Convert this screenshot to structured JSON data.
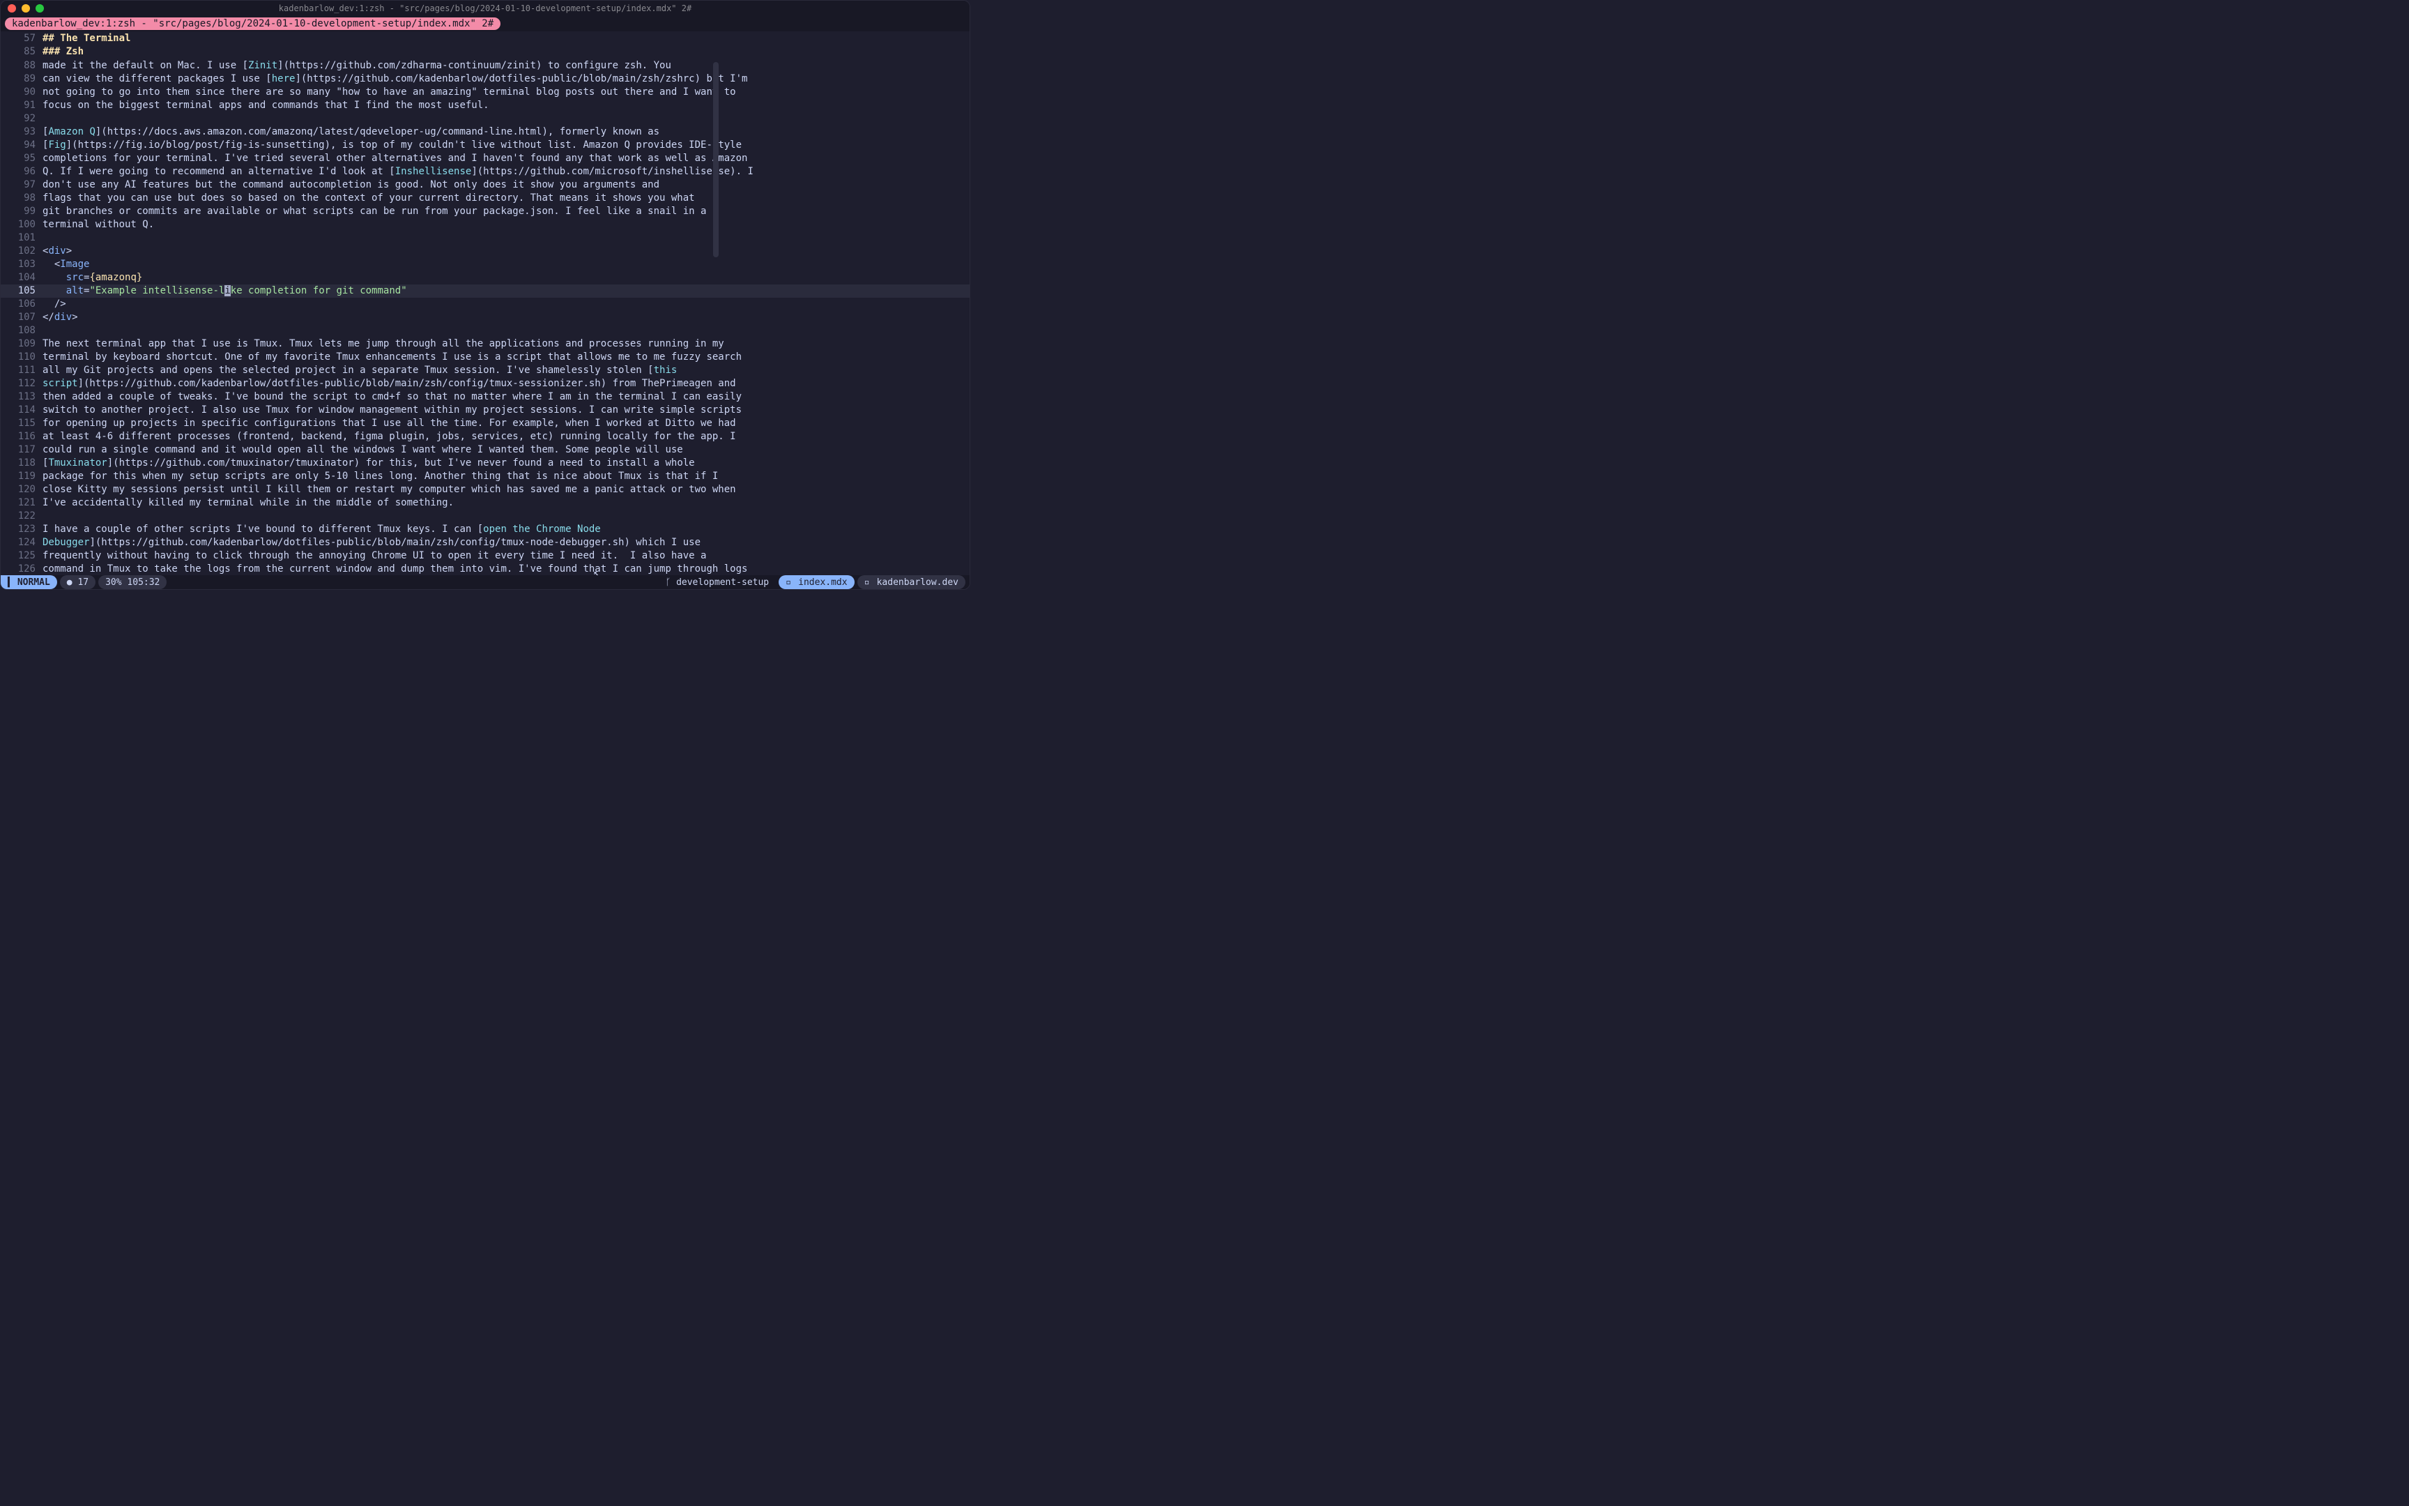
{
  "window": {
    "title": "kadenbarlow_dev:1:zsh - \"src/pages/blog/2024-01-10-development-setup/index.mdx\" 2#"
  },
  "tmux": {
    "tab": "kadenbarlow_dev:1:zsh - \"src/pages/blog/2024-01-10-development-setup/index.mdx\" 2#"
  },
  "breadcrumbs": [
    {
      "num": "57",
      "text": "## The Terminal"
    },
    {
      "num": "85",
      "text": "### Zsh"
    }
  ],
  "lines": [
    {
      "num": "88",
      "segs": [
        [
          "t",
          "made it the default on Mac. I use ["
        ],
        [
          "l",
          "Zinit"
        ],
        [
          "t",
          "](https://github.com/zdharma-continuum/zinit) to configure zsh. You"
        ]
      ]
    },
    {
      "num": "89",
      "segs": [
        [
          "t",
          "can view the different packages I use ["
        ],
        [
          "l",
          "here"
        ],
        [
          "t",
          "](https://github.com/kadenbarlow/dotfiles-public/blob/main/zsh/zshrc) but I'm"
        ]
      ]
    },
    {
      "num": "90",
      "segs": [
        [
          "t",
          "not going to go into them since there are so many \"how to have an amazing\" terminal blog posts out there and I want to"
        ]
      ]
    },
    {
      "num": "91",
      "segs": [
        [
          "t",
          "focus on the biggest terminal apps and commands that I find the most useful."
        ]
      ]
    },
    {
      "num": "92",
      "segs": [
        [
          "t",
          ""
        ]
      ]
    },
    {
      "num": "93",
      "segs": [
        [
          "t",
          "["
        ],
        [
          "l",
          "Amazon Q"
        ],
        [
          "t",
          "](https://docs.aws.amazon.com/amazonq/latest/qdeveloper-ug/command-line.html), formerly known as"
        ]
      ]
    },
    {
      "num": "94",
      "segs": [
        [
          "t",
          "["
        ],
        [
          "l",
          "Fig"
        ],
        [
          "t",
          "](https://fig.io/blog/post/fig-is-sunsetting), is top of my couldn't live without list. Amazon Q provides IDE-style"
        ]
      ]
    },
    {
      "num": "95",
      "segs": [
        [
          "t",
          "completions for your terminal. I've tried several other alternatives and I haven't found any that work as well as Amazon"
        ]
      ]
    },
    {
      "num": "96",
      "segs": [
        [
          "t",
          "Q. If I were going to recommend an alternative I'd look at ["
        ],
        [
          "l",
          "Inshellisense"
        ],
        [
          "t",
          "](https://github.com/microsoft/inshellisense). I"
        ]
      ]
    },
    {
      "num": "97",
      "segs": [
        [
          "t",
          "don't use any AI features but the command autocompletion is good. Not only does it show you arguments and"
        ]
      ]
    },
    {
      "num": "98",
      "segs": [
        [
          "t",
          "flags that you can use but does so based on the context of your current directory. That means it shows you what"
        ]
      ]
    },
    {
      "num": "99",
      "segs": [
        [
          "t",
          "git branches or commits are available or what scripts can be run from your package.json. I feel like a snail in a"
        ]
      ]
    },
    {
      "num": "100",
      "segs": [
        [
          "t",
          "terminal without Q."
        ]
      ]
    },
    {
      "num": "101",
      "segs": [
        [
          "t",
          ""
        ]
      ]
    },
    {
      "num": "102",
      "segs": [
        [
          "p",
          "<"
        ],
        [
          "tag",
          "div"
        ],
        [
          "p",
          ">"
        ]
      ]
    },
    {
      "num": "103",
      "segs": [
        [
          "t",
          "  "
        ],
        [
          "p",
          "<"
        ],
        [
          "tag",
          "Image"
        ]
      ]
    },
    {
      "num": "104",
      "segs": [
        [
          "t",
          "    "
        ],
        [
          "attr",
          "src"
        ],
        [
          "p",
          "="
        ],
        [
          "e",
          "{amazonq}"
        ]
      ]
    },
    {
      "num": "105",
      "current": true,
      "segs": [
        [
          "t",
          "    "
        ],
        [
          "attr",
          "alt"
        ],
        [
          "p",
          "="
        ],
        [
          "s",
          "\"Example intellisense-l"
        ],
        [
          "cur",
          "i"
        ],
        [
          "s",
          "ke completion for git command\""
        ]
      ]
    },
    {
      "num": "106",
      "segs": [
        [
          "t",
          "  "
        ],
        [
          "p",
          "/>"
        ]
      ]
    },
    {
      "num": "107",
      "segs": [
        [
          "p",
          "</"
        ],
        [
          "tag",
          "div"
        ],
        [
          "p",
          ">"
        ]
      ]
    },
    {
      "num": "108",
      "segs": [
        [
          "t",
          ""
        ]
      ]
    },
    {
      "num": "109",
      "segs": [
        [
          "t",
          "The next terminal app that I use is Tmux. Tmux lets me jump through all the applications and processes running in my"
        ]
      ]
    },
    {
      "num": "110",
      "segs": [
        [
          "t",
          "terminal by keyboard shortcut. One of my favorite Tmux enhancements I use is a script that allows me to me fuzzy search"
        ]
      ]
    },
    {
      "num": "111",
      "segs": [
        [
          "t",
          "all my Git projects and opens the selected project in a separate Tmux session. I've shamelessly stolen ["
        ],
        [
          "l",
          "this"
        ]
      ]
    },
    {
      "num": "112",
      "segs": [
        [
          "l",
          "script"
        ],
        [
          "t",
          "](https://github.com/kadenbarlow/dotfiles-public/blob/main/zsh/config/tmux-sessionizer.sh) from ThePrimeagen and"
        ]
      ]
    },
    {
      "num": "113",
      "segs": [
        [
          "t",
          "then added a couple of tweaks. I've bound the script to cmd+f so that no matter where I am in the terminal I can easily"
        ]
      ]
    },
    {
      "num": "114",
      "segs": [
        [
          "t",
          "switch to another project. I also use Tmux for window management within my project sessions. I can write simple scripts"
        ]
      ]
    },
    {
      "num": "115",
      "segs": [
        [
          "t",
          "for opening up projects in specific configurations that I use all the time. For example, when I worked at Ditto we had"
        ]
      ]
    },
    {
      "num": "116",
      "segs": [
        [
          "t",
          "at least 4-6 different processes (frontend, backend, figma plugin, jobs, services, etc) running locally for the app. I"
        ]
      ]
    },
    {
      "num": "117",
      "segs": [
        [
          "t",
          "could run a single command and it would open all the windows I want where I wanted them. Some people will use"
        ]
      ]
    },
    {
      "num": "118",
      "segs": [
        [
          "t",
          "["
        ],
        [
          "l",
          "Tmuxinator"
        ],
        [
          "t",
          "](https://github.com/tmuxinator/tmuxinator) for this, but I've never found a need to install a whole"
        ]
      ]
    },
    {
      "num": "119",
      "segs": [
        [
          "t",
          "package for this when my setup scripts are only 5-10 lines long. Another thing that is nice about Tmux is that if I"
        ]
      ]
    },
    {
      "num": "120",
      "segs": [
        [
          "t",
          "close Kitty my sessions persist until I kill them or restart my computer which has saved me a panic attack or two when"
        ]
      ]
    },
    {
      "num": "121",
      "segs": [
        [
          "t",
          "I've accidentally killed my terminal while in the middle of something."
        ]
      ]
    },
    {
      "num": "122",
      "segs": [
        [
          "t",
          ""
        ]
      ]
    },
    {
      "num": "123",
      "segs": [
        [
          "t",
          "I have a couple of other scripts I've bound to different Tmux keys. I can ["
        ],
        [
          "l",
          "open the Chrome Node"
        ]
      ]
    },
    {
      "num": "124",
      "segs": [
        [
          "l",
          "Debugger"
        ],
        [
          "t",
          "](https://github.com/kadenbarlow/dotfiles-public/blob/main/zsh/config/tmux-node-debugger.sh) which I use"
        ]
      ]
    },
    {
      "num": "125",
      "segs": [
        [
          "t",
          "frequently without having to click through the annoying Chrome UI to open it every time I need it.  I also have a"
        ]
      ]
    },
    {
      "num": "126",
      "segs": [
        [
          "t",
          "command in Tmux to take the logs from the current window and dump them into vim. I've found that I can jump through logs"
        ]
      ]
    }
  ],
  "status": {
    "mode": "NORMAL",
    "diag_icon": "●",
    "diag_count": "17",
    "percent": "30%",
    "pos": "105:32",
    "git_icon": "ᚴ",
    "git_branch": "development-setup",
    "tabs": [
      {
        "icon": "▫",
        "label": "index.mdx",
        "active": true
      },
      {
        "icon": "▫",
        "label": "kadenbarlow.dev",
        "active": false
      }
    ]
  }
}
